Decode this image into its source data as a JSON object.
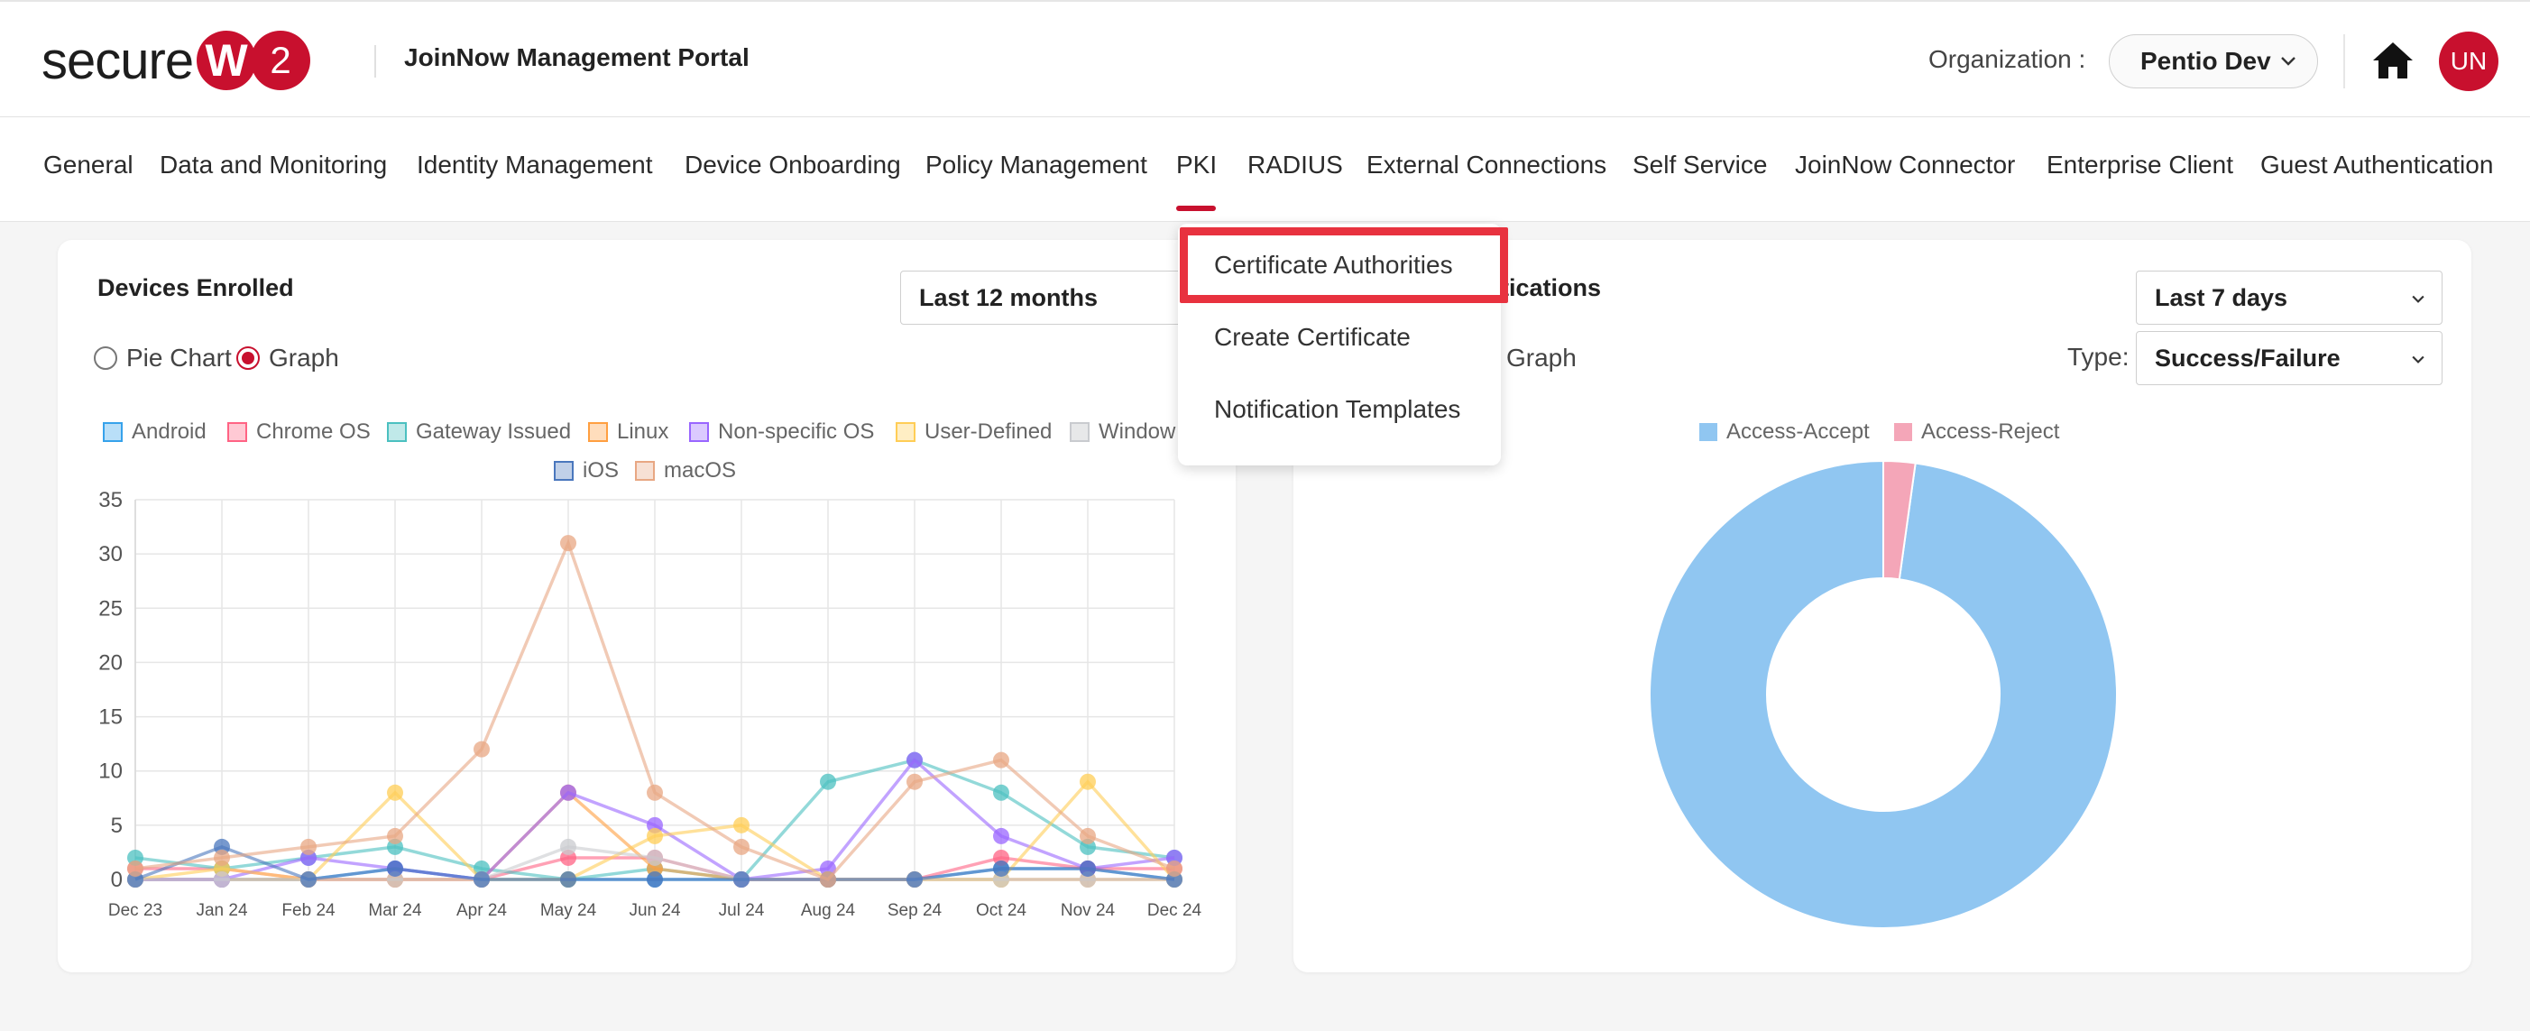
{
  "header": {
    "logo_text": "secure",
    "logo_letter": "W",
    "logo_number": "2",
    "portal_title": "JoinNow Management Portal",
    "org_label": "Organization :",
    "org_value": "Pentio Dev",
    "avatar_initials": "UN",
    "brand_color": "#c8102e"
  },
  "nav": {
    "items": [
      {
        "label": "General"
      },
      {
        "label": "Data and Monitoring"
      },
      {
        "label": "Identity Management"
      },
      {
        "label": "Device Onboarding"
      },
      {
        "label": "Policy Management"
      },
      {
        "label": "PKI"
      },
      {
        "label": "RADIUS"
      },
      {
        "label": "External Connections"
      },
      {
        "label": "Self Service"
      },
      {
        "label": "JoinNow Connector"
      },
      {
        "label": "Enterprise Client"
      },
      {
        "label": "Guest Authentication"
      }
    ],
    "active": "PKI"
  },
  "pki_dropdown": {
    "items": [
      {
        "label": "Certificate Authorities"
      },
      {
        "label": "Create Certificate"
      },
      {
        "label": "Notification Templates"
      }
    ],
    "highlighted": "Certificate Authorities"
  },
  "devices_card": {
    "title": "Devices Enrolled",
    "range_value": "Last 12 months",
    "radio_pie": "Pie Chart",
    "radio_graph": "Graph",
    "selected_view": "Graph"
  },
  "auth_card": {
    "title_visible": "tications",
    "range_value": "Last 7 days",
    "radio_graph": "Graph",
    "type_label": "Type:",
    "type_value": "Success/Failure"
  },
  "chart_data": [
    {
      "type": "line",
      "categories": [
        "Dec 23",
        "Jan 24",
        "Feb 24",
        "Mar 24",
        "Apr 24",
        "May 24",
        "Jun 24",
        "Jul 24",
        "Aug 24",
        "Sep 24",
        "Oct 24",
        "Nov 24",
        "Dec 24"
      ],
      "ylim": [
        0,
        35
      ],
      "yticks": [
        0,
        5,
        10,
        15,
        20,
        25,
        30,
        35
      ],
      "grid": true,
      "legend_position": "top",
      "series": [
        {
          "name": "Android",
          "color": "#36a2eb",
          "values": [
            0,
            0,
            0,
            1,
            0,
            0,
            0,
            0,
            0,
            0,
            1,
            1,
            0
          ]
        },
        {
          "name": "Chrome OS",
          "color": "#ff6384",
          "values": [
            1,
            1,
            0,
            0,
            0,
            2,
            2,
            0,
            0,
            0,
            2,
            1,
            1
          ]
        },
        {
          "name": "Gateway Issued",
          "color": "#4bc0c0",
          "values": [
            2,
            1,
            2,
            3,
            1,
            0,
            1,
            0,
            9,
            11,
            8,
            3,
            2
          ]
        },
        {
          "name": "Linux",
          "color": "#ff9f40",
          "values": [
            0,
            0,
            0,
            0,
            0,
            8,
            1,
            0,
            0,
            0,
            0,
            0,
            0
          ]
        },
        {
          "name": "Non-specific OS",
          "color": "#9966ff",
          "values": [
            0,
            0,
            2,
            1,
            0,
            8,
            5,
            0,
            1,
            11,
            4,
            1,
            2
          ]
        },
        {
          "name": "User-Defined",
          "color": "#ffcd56",
          "values": [
            0,
            1,
            0,
            8,
            0,
            0,
            4,
            5,
            0,
            0,
            0,
            9,
            0
          ]
        },
        {
          "name": "Windows",
          "color": "#c9cbcf",
          "values": [
            0,
            0,
            0,
            0,
            0,
            3,
            2,
            0,
            0,
            0,
            0,
            0,
            0
          ]
        },
        {
          "name": "iOS",
          "color": "#4a77bd",
          "values": [
            0,
            3,
            0,
            1,
            0,
            0,
            0,
            0,
            0,
            0,
            1,
            1,
            0
          ]
        },
        {
          "name": "macOS",
          "color": "#e8a783",
          "values": [
            1,
            2,
            3,
            4,
            12,
            31,
            8,
            3,
            0,
            9,
            11,
            4,
            1
          ]
        }
      ],
      "legend_labels": [
        "Android",
        "Chrome OS",
        "Gateway Issued",
        "Linux",
        "Non-specific OS",
        "User-Defined",
        "Window",
        "iOS",
        "macOS"
      ]
    },
    {
      "type": "pie",
      "variant": "doughnut",
      "legend_position": "top",
      "series": [
        {
          "name": "Access-Accept",
          "color": "#90c6f1",
          "value": 97.8
        },
        {
          "name": "Access-Reject",
          "color": "#f4a6b8",
          "value": 2.2
        }
      ]
    }
  ]
}
